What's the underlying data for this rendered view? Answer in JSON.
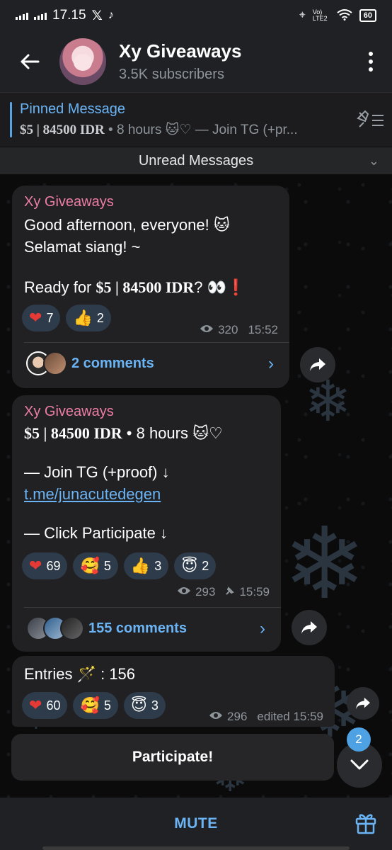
{
  "status_bar": {
    "time": "17.15",
    "network": "Vo) LTE2",
    "battery": "60"
  },
  "header": {
    "title": "Xy Giveaways",
    "subtitle": "3.5K subscribers"
  },
  "pinned": {
    "label": "Pinned Message",
    "amount": "$5 | 84500 IDR",
    "rest": " • 8 hours 🐱♡ — Join TG (+pr..."
  },
  "unread_label": "Unread Messages",
  "messages": [
    {
      "sender": "Xy Giveaways",
      "line1": "Good afternoon, everyone! 🐱",
      "line2": "Selamat siang! ~",
      "line3_pre": "Ready for ",
      "line3_bold": "$5 | 84500 IDR",
      "line3_post": "? 👀❗",
      "reactions": [
        {
          "emoji": "❤",
          "count": "7"
        },
        {
          "emoji": "👍",
          "count": "2"
        }
      ],
      "views": "320",
      "time": "15:52",
      "comments": "2 comments"
    },
    {
      "sender": "Xy Giveaways",
      "line1_bold": "$5 | 84500 IDR",
      "line1_post": " • 8 hours 🐱♡",
      "line2": "— Join TG (+proof) ↓",
      "link": "t.me/junacutedegen",
      "line3": "— Click Participate ↓",
      "reactions": [
        {
          "emoji": "❤",
          "count": "69"
        },
        {
          "emoji": "🥰",
          "count": "5"
        },
        {
          "emoji": "👍",
          "count": "3"
        },
        {
          "emoji": "😇",
          "count": "2"
        }
      ],
      "views": "293",
      "time": "15:59",
      "comments": "155 comments"
    },
    {
      "line1": "Entries 🪄 : 156",
      "reactions": [
        {
          "emoji": "❤",
          "count": "60"
        },
        {
          "emoji": "🥰",
          "count": "5"
        },
        {
          "emoji": "😇",
          "count": "3"
        }
      ],
      "views": "296",
      "time": "edited 15:59"
    }
  ],
  "participate_label": "Participate!",
  "unread_count": "2",
  "mute_label": "MUTE",
  "colors": {
    "accent": "#6ab4f5",
    "sender": "#ee7ea4",
    "bubble": "#212123",
    "reaction": "#2d3b4a"
  }
}
